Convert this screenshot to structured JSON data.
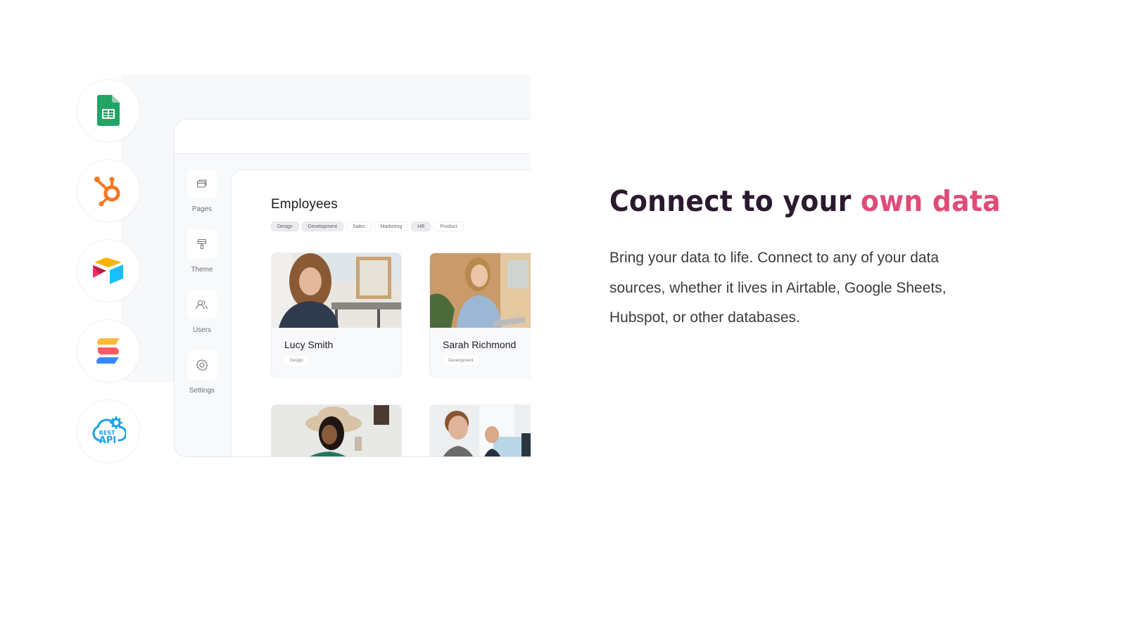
{
  "integrations": [
    {
      "name": "Google Sheets",
      "icon": "google-sheets-icon",
      "color": "#21a464"
    },
    {
      "name": "HubSpot",
      "icon": "hubspot-icon",
      "color": "#f57722"
    },
    {
      "name": "Airtable",
      "icon": "airtable-icon",
      "color": "#fcb400"
    },
    {
      "name": "SmartSuite",
      "icon": "smartsuite-icon",
      "color": "#ff5a5f"
    },
    {
      "name": "REST API",
      "icon": "rest-api-icon",
      "color": "#1aa3e8",
      "label_top": "REST",
      "label_bottom": "API"
    }
  ],
  "app": {
    "sidebar": [
      {
        "label": "Pages",
        "icon": "pages-icon"
      },
      {
        "label": "Theme",
        "icon": "paint-roller-icon"
      },
      {
        "label": "Users",
        "icon": "users-icon"
      },
      {
        "label": "Settings",
        "icon": "gear-icon"
      }
    ],
    "page_title": "Employees",
    "filters": [
      {
        "label": "Design",
        "active": true
      },
      {
        "label": "Development",
        "active": true
      },
      {
        "label": "Sales",
        "active": false
      },
      {
        "label": "Marketing",
        "active": false
      },
      {
        "label": "HR",
        "active": true
      },
      {
        "label": "Product",
        "active": false
      }
    ],
    "employees": [
      {
        "name": "Lucy Smith",
        "department": "Design"
      },
      {
        "name": "Sarah Richmond",
        "department": "Development"
      },
      {
        "name": "",
        "department": ""
      },
      {
        "name": "",
        "department": ""
      }
    ]
  },
  "hero": {
    "headline_main": "Connect to your ",
    "headline_accent": "own data",
    "accent_color": "#de4c78",
    "description": "Bring your data to life. Connect to any of your data sources, whether it lives in Airtable, Google Sheets, Hubspot, or other databases."
  }
}
